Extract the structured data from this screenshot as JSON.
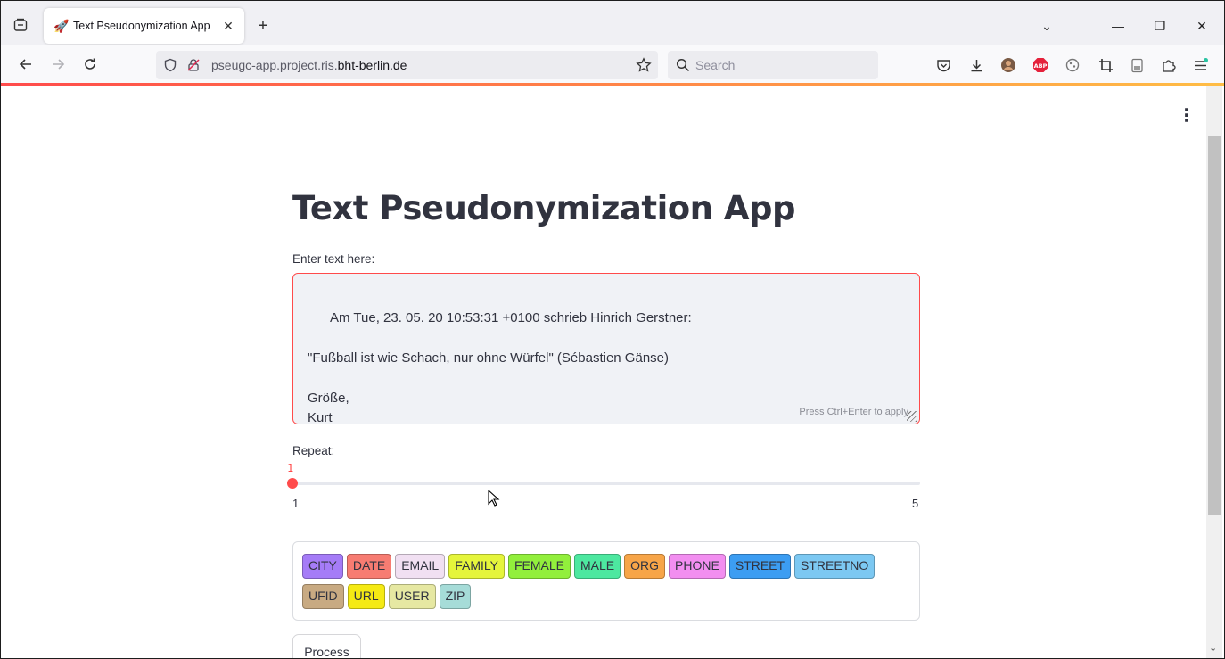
{
  "browser": {
    "tab_title": "Text Pseudonymization App",
    "tab_favicon": "rocket-icon",
    "url_plain": "pseugc-app.project.ris.",
    "url_domain": "bht-berlin.de",
    "search_placeholder": "Search"
  },
  "app": {
    "title": "Text Pseudonymization App",
    "input_label": "Enter text here:",
    "input_text": "Am Tue, 23. 05. 20 10:53:31 +0100 schrieb Hinrich Gerstner:\n\n\"Fußball ist wie Schach, nur ohne Würfel\" (Sébastien Gänse)\n\nGröße,\nKurt",
    "input_hint": "Press Ctrl+Enter to apply",
    "repeat_label": "Repeat:",
    "repeat_value": "1",
    "repeat_min": "1",
    "repeat_max": "5",
    "process_label": "Process"
  },
  "tags": [
    {
      "label": "CITY",
      "color": "#a57cf7"
    },
    {
      "label": "DATE",
      "color": "#f77c72"
    },
    {
      "label": "EMAIL",
      "color": "#f1e0f2"
    },
    {
      "label": "FAMILY",
      "color": "#e5f53b"
    },
    {
      "label": "FEMALE",
      "color": "#92ef3c"
    },
    {
      "label": "MALE",
      "color": "#4de8a0"
    },
    {
      "label": "ORG",
      "color": "#f7a548"
    },
    {
      "label": "PHONE",
      "color": "#f28ef0"
    },
    {
      "label": "STREET",
      "color": "#3c9df2"
    },
    {
      "label": "STREETNO",
      "color": "#7cc8f2"
    },
    {
      "label": "UFID",
      "color": "#c8aa82"
    },
    {
      "label": "URL",
      "color": "#f5ea14"
    },
    {
      "label": "USER",
      "color": "#e6e8a2"
    },
    {
      "label": "ZIP",
      "color": "#a6dcd8"
    }
  ]
}
